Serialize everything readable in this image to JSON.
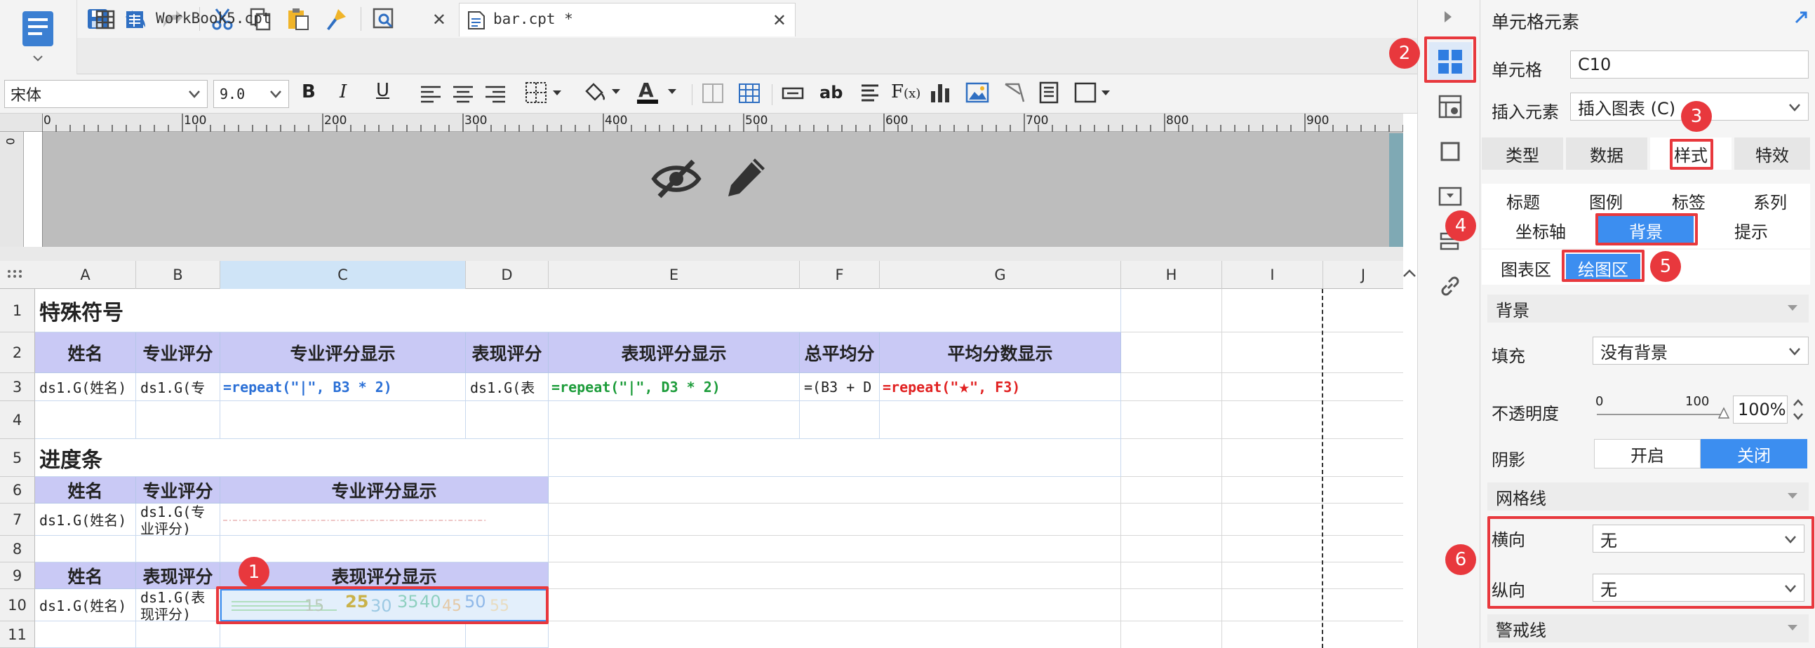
{
  "tabs": [
    {
      "label": "WorkBook5.cpt",
      "active": false
    },
    {
      "label": "bar.cpt *",
      "active": true
    }
  ],
  "format": {
    "font_family": "宋体",
    "font_size": "9.0"
  },
  "ruler": {
    "ticks": [
      "0",
      "100",
      "200",
      "300",
      "400",
      "500",
      "600",
      "700",
      "800",
      "900"
    ],
    "vertical_tick": "0"
  },
  "columns": [
    "A",
    "B",
    "C",
    "D",
    "E",
    "F",
    "G",
    "H",
    "I",
    "J"
  ],
  "rows": [
    "1",
    "2",
    "3",
    "4",
    "5",
    "6",
    "7",
    "8",
    "9",
    "10",
    "11"
  ],
  "sheet": {
    "r1_title": "特殊符号",
    "r2_headers": [
      "姓名",
      "专业评分",
      "专业评分显示",
      "表现评分",
      "表现评分显示",
      "总平均分",
      "平均分数显示"
    ],
    "r3": {
      "a": "ds1.G(姓名)",
      "b": "ds1.G(专",
      "c": "=repeat(\"|\", B3 * 2)",
      "d": "ds1.G(表",
      "e": "=repeat(\"|\", D3 * 2)",
      "f": "=(B3 + D",
      "g_prefix": "=repeat(\"",
      "g_star": "★",
      "g_suffix": "\", F3)"
    },
    "r5_title": "进度条",
    "r6_headers": [
      "姓名",
      "专业评分",
      "专业评分显示"
    ],
    "r7": {
      "a": "ds1.G(姓名)",
      "b": "ds1.G(专",
      "b2": "业评分)"
    },
    "r9_headers": [
      "姓名",
      "表现评分",
      "表现评分显示"
    ],
    "r10": {
      "a": "ds1.G(姓名)",
      "b": "ds1.G(表",
      "b2": "现评分)",
      "chart_labels": [
        "15",
        "25",
        "30",
        "35",
        "40",
        "45",
        "50",
        "55"
      ]
    }
  },
  "panel": {
    "title": "单元格元素",
    "cell_label": "单元格",
    "cell_value": "C10",
    "insert_label": "插入元素",
    "insert_value": "插入图表 (C)",
    "main_tabs": [
      "类型",
      "数据",
      "样式",
      "特效"
    ],
    "sub_tabs_row1": [
      "标题",
      "图例",
      "标签",
      "系列"
    ],
    "sub_tabs_row2": [
      "坐标轴",
      "背景",
      "提示"
    ],
    "area_tabs": [
      "图表区",
      "绘图区"
    ],
    "background_section": "背景",
    "fill_label": "填充",
    "fill_value": "没有背景",
    "opacity_label": "不透明度",
    "opacity_min": "0",
    "opacity_max": "100",
    "opacity_value": "100%",
    "shadow_label": "阴影",
    "shadow_on": "开启",
    "shadow_off": "关闭",
    "grid_section": "网格线",
    "horizontal_label": "横向",
    "horizontal_value": "无",
    "vertical_label": "纵向",
    "vertical_value": "无",
    "warning_section": "警戒线"
  },
  "badges": [
    "1",
    "2",
    "3",
    "4",
    "5",
    "6"
  ],
  "colors": {
    "accent": "#3c8ef0",
    "annotation": "#e8383d",
    "header_fill": "#c9c9f5"
  }
}
